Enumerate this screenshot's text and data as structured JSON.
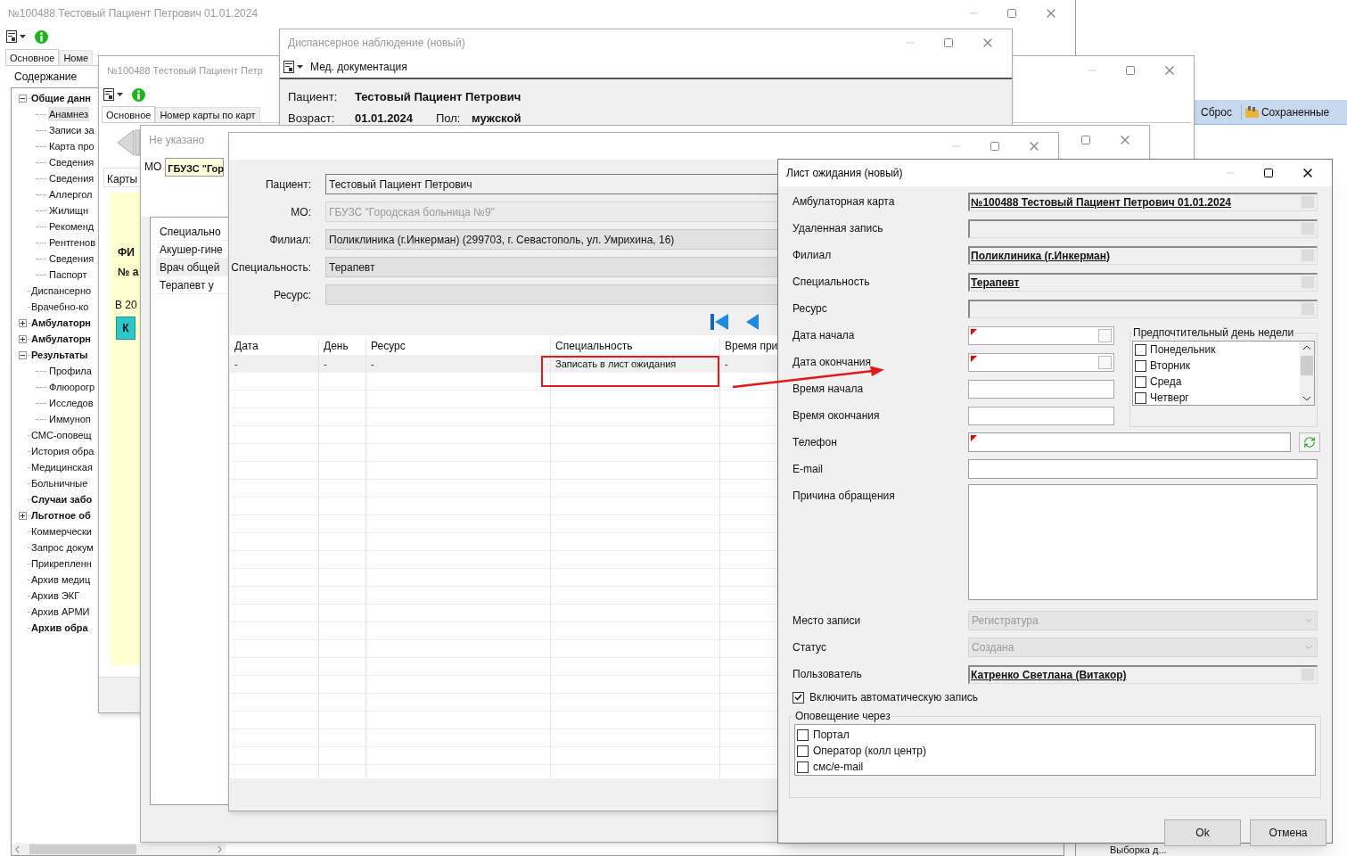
{
  "main_window": {
    "title": "№100488 Тестовый Пациент Петрович 01.01.2024",
    "tabs": [
      {
        "label": "Основное",
        "selected": true
      },
      {
        "label": "Номе",
        "selected": false
      }
    ],
    "group_title": "Содержание",
    "tree": [
      {
        "label": "Общие данн",
        "bold": true,
        "expanded": true,
        "children": [
          {
            "label": "Анамнез",
            "bold": false,
            "selected": true
          },
          {
            "label": "Записи за",
            "bold": false,
            "selected": false
          },
          {
            "label": "Карта про",
            "bold": false,
            "selected": false
          },
          {
            "label": "Сведения",
            "bold": false,
            "selected": false
          },
          {
            "label": "Сведения",
            "bold": false,
            "selected": false
          },
          {
            "label": "Аллергол",
            "bold": false,
            "selected": false
          },
          {
            "label": "Жилищн",
            "bold": false,
            "selected": false
          },
          {
            "label": "Рекоменд",
            "bold": false,
            "selected": false
          },
          {
            "label": "Рентгенов",
            "bold": false,
            "selected": false
          },
          {
            "label": "Сведения",
            "bold": false,
            "selected": false
          },
          {
            "label": "Паспорт",
            "bold": false,
            "selected": false
          }
        ]
      },
      {
        "label": "Диспансерно",
        "bold": false
      },
      {
        "label": "Врачебно-ко",
        "bold": false
      },
      {
        "label": "Амбулаторн",
        "bold": true,
        "expanded": false
      },
      {
        "label": "Амбулаторн",
        "bold": true,
        "expanded": false
      },
      {
        "label": "Результаты",
        "bold": true,
        "expanded": true,
        "children": [
          {
            "label": "Профила",
            "bold": false,
            "selected": false
          },
          {
            "label": "Флюорогр",
            "bold": false,
            "selected": false
          },
          {
            "label": "Исследов",
            "bold": false,
            "selected": false
          },
          {
            "label": "Иммуноп",
            "bold": false,
            "selected": false
          }
        ]
      },
      {
        "label": "СМС-оповещ",
        "bold": false
      },
      {
        "label": "История обра",
        "bold": false
      },
      {
        "label": "Медицинская",
        "bold": false
      },
      {
        "label": "Больничные",
        "bold": false
      },
      {
        "label": "Случаи забо",
        "bold": true
      },
      {
        "label": "Льготное об",
        "bold": true,
        "expanded": false
      },
      {
        "label": "Коммерчески",
        "bold": false
      },
      {
        "label": "Запрос докум",
        "bold": false
      },
      {
        "label": "Прикрепленн",
        "bold": false
      },
      {
        "label": "Архив медиц",
        "bold": false
      },
      {
        "label": "Архив ЭКГ",
        "bold": false
      },
      {
        "label": "Архив АРМИ",
        "bold": false
      },
      {
        "label": "Архив обра",
        "bold": true
      }
    ]
  },
  "background_window": {
    "toolbar": [
      {
        "label": "Сброс",
        "kind": "button"
      },
      {
        "label": "Сохраненные",
        "kind": "menu"
      }
    ],
    "status": "Выборка д..."
  },
  "card_window": {
    "title": "№100488 Тестовый Пациент Петр",
    "tabs": [
      {
        "label": "Основное",
        "selected": true
      },
      {
        "label": "Номер карты по карт",
        "selected": false
      }
    ],
    "sub_tab": "Карты",
    "info": [
      "ФИ",
      "№ а"
    ],
    "year": "В 20",
    "action_button": "К"
  },
  "dispensary_window": {
    "title": "Диспансерное наблюдение (новый)",
    "menu": "Мед. документация",
    "patient_label": "Пациент:",
    "patient": "Тестовый Пациент Петрович",
    "age_label": "Возраст:",
    "age": "01.01.2024",
    "sex_label": "Пол:",
    "sex": "мужской"
  },
  "specialty_window": {
    "title": "Не указано",
    "mo_label": "МО",
    "mo": "ГБУЗС \"Гор",
    "specialties": [
      {
        "label": "Специально",
        "selected": false
      },
      {
        "label": "Акушер-гине",
        "selected": false
      },
      {
        "label": "Врач общей",
        "selected": true
      },
      {
        "label": "Терапевт у",
        "selected": false
      }
    ]
  },
  "schedule_window": {
    "fields": [
      {
        "label": "Пациент:",
        "value": "Тестовый Пациент Петрович",
        "disabled": false
      },
      {
        "label": "МО:",
        "value": "ГБУЗС \"Городская больница №9\"",
        "disabled": true
      },
      {
        "label": "Филиал:",
        "value": "Поликлиника (г.Инкерман) (299703, г. Севастополь, ул. Умрихина, 16)",
        "disabled": false
      },
      {
        "label": "Специальность:",
        "value": "Терапевт",
        "disabled": false
      },
      {
        "label": "Ресурс:",
        "disabled": false
      }
    ],
    "table": {
      "columns": [
        "Дата",
        "День",
        "Ресурс",
        "Специальность",
        "Время при"
      ],
      "rows": [
        [
          "-",
          "-",
          "-",
          "Записать в лист ожидания",
          "-"
        ]
      ]
    }
  },
  "waitlist_dialog": {
    "title": "Лист ожидания (новый)",
    "card_fields": [
      {
        "label": "Амбулаторная карта",
        "kind": "lookup",
        "value": "№100488 Тестовый Пациент Петрович 01.01.2024"
      },
      {
        "label": "Удаленная запись",
        "kind": "lookup"
      },
      {
        "label": "Филиал",
        "kind": "lookup",
        "value": "Поликлиника (г.Инкерман)"
      },
      {
        "label": "Специальность",
        "kind": "lookup",
        "value": "Терапевт"
      },
      {
        "label": "Ресурс",
        "kind": "lookup"
      }
    ],
    "period_fields": [
      {
        "label": "Дата начала",
        "kind": "date",
        "required": true
      },
      {
        "label": "Дата окончания",
        "kind": "date",
        "required": true
      },
      {
        "label": "Время начала",
        "kind": "time",
        "required": false
      },
      {
        "label": "Время окончания",
        "kind": "time",
        "required": false
      }
    ],
    "weekday_group": {
      "title": "Предпочтительный день недели",
      "days": [
        {
          "label": "Понедельник",
          "checked": false
        },
        {
          "label": "Вторник",
          "checked": false
        },
        {
          "label": "Среда",
          "checked": false
        },
        {
          "label": "Четверг",
          "checked": false
        }
      ]
    },
    "contact_fields": [
      {
        "label": "Телефон",
        "kind": "phone",
        "required": true
      },
      {
        "label": "E-mail",
        "kind": "text",
        "required": false
      },
      {
        "label": "Причина обращения",
        "kind": "memo",
        "required": false
      }
    ],
    "choice_fields": [
      {
        "label": "Место записи",
        "kind": "select",
        "value": "Регистратура"
      },
      {
        "label": "Статус",
        "kind": "select",
        "value": "Создана"
      },
      {
        "label": "Пользователь",
        "kind": "lookup",
        "value": "Катренко Светлана (Витакор)"
      }
    ],
    "auto_record": {
      "label": "Включить автоматическую запись",
      "checked": true
    },
    "notify_group": {
      "title": "Оповещение через",
      "channels": [
        {
          "label": "Портал",
          "checked": false
        },
        {
          "label": "Оператор (колл центр)",
          "checked": false
        },
        {
          "label": "смс/e-mail",
          "checked": false
        }
      ]
    },
    "buttons": [
      "Ok",
      "Отмена"
    ]
  }
}
